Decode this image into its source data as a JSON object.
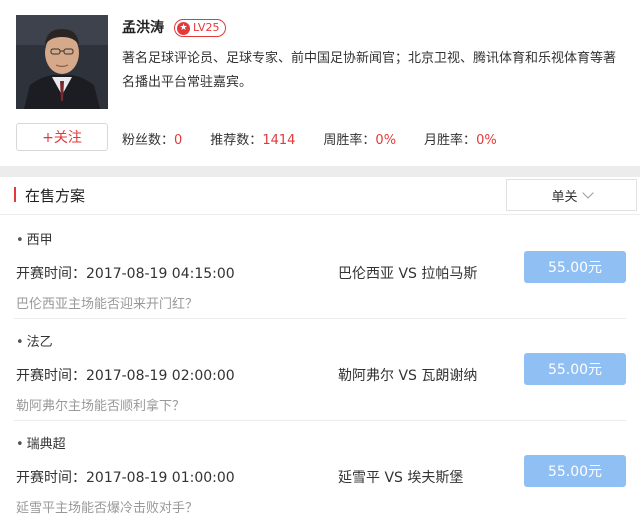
{
  "expert": {
    "name": "孟洪涛",
    "level": "LV25",
    "bio": "著名足球评论员、足球专家、前中国足协新闻官；北京卫视、腾讯体育和乐视体育等著名播出平台常驻嘉宾。",
    "follow_label": "+关注",
    "stats": [
      {
        "label": "粉丝数：",
        "value": "0"
      },
      {
        "label": "推荐数：",
        "value": "1414"
      },
      {
        "label": "周胜率：",
        "value": "0%"
      },
      {
        "label": "月胜率：",
        "value": "0%"
      }
    ]
  },
  "plans_section": {
    "title": "在售方案",
    "sort_selected": "单关"
  },
  "plans": [
    {
      "league": "西甲",
      "time": "开赛时间：2017-08-19 04:15:00",
      "match": "巴伦西亚 VS 拉帕马斯",
      "price": "55.00元",
      "question": "巴伦西亚主场能否迎来开门红？"
    },
    {
      "league": "法乙",
      "time": "开赛时间：2017-08-19 02:00:00",
      "match": "勒阿弗尔 VS 瓦朗谢纳",
      "price": "55.00元",
      "question": "勒阿弗尔主场能否顺利拿下？"
    },
    {
      "league": "瑞典超",
      "time": "开赛时间：2017-08-19 01:00:00",
      "match": "延雪平 VS 埃夫斯堡",
      "price": "55.00元",
      "question": "延雪平主场能否爆冷击败对手？"
    }
  ],
  "colors": {
    "accent": "#e23a3a",
    "price_button": "#8fbff3",
    "background": "#ececec"
  }
}
